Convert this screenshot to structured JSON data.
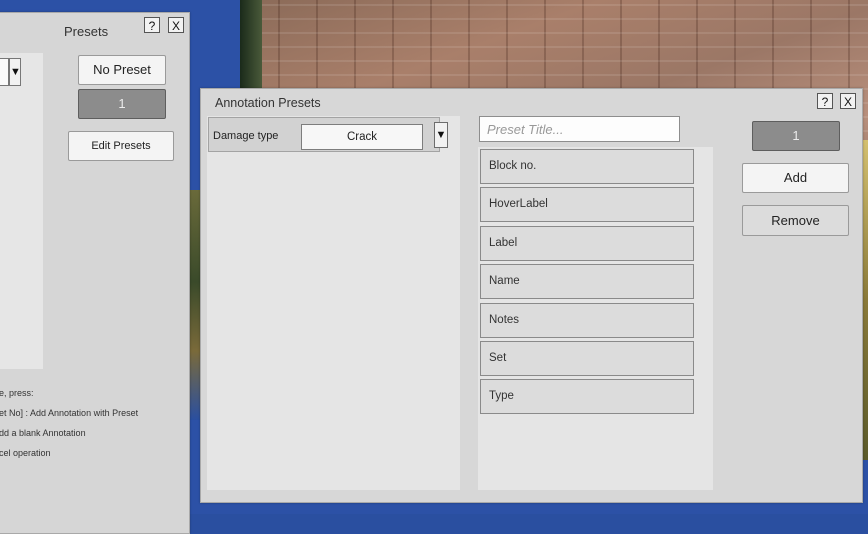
{
  "presets_window": {
    "title": "Presets",
    "help_button": "?",
    "close_button": "X",
    "dropdown_arrow": "▼",
    "no_preset_button": "No Preset",
    "preset_number_button": "1",
    "edit_presets_button": "Edit Presets",
    "help_lines": [
      "e, press:",
      "et No] : Add Annotation with Preset",
      "dd a blank Annotation",
      "cel operation"
    ]
  },
  "annotation_presets_window": {
    "title": "Annotation Presets",
    "help_button": "?",
    "close_button": "X",
    "field": {
      "label": "Damage type",
      "value": "Crack",
      "dropdown_arrow": "▼"
    },
    "preset_title_placeholder": "Preset Title...",
    "key_buttons": [
      "Block no.",
      "HoverLabel",
      "Label",
      "Name",
      "Notes",
      "Set",
      "Type"
    ],
    "preset_number_button": "1",
    "add_button": "Add",
    "remove_button": "Remove"
  }
}
